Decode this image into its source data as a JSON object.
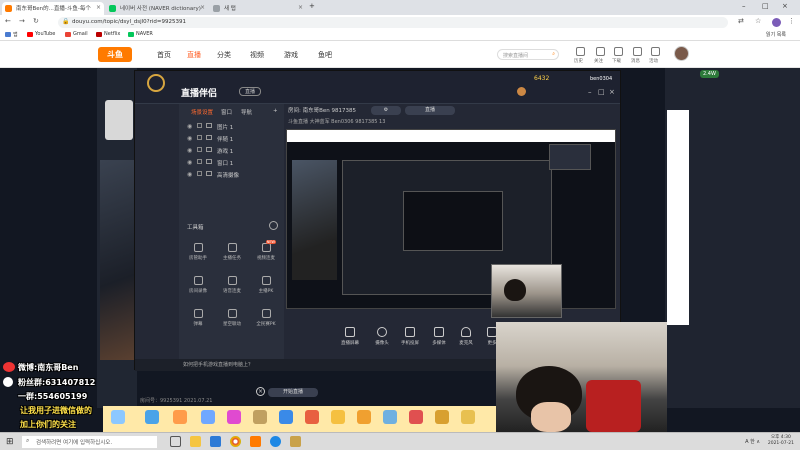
{
  "browser": {
    "tabs": [
      {
        "label": "南东哥Ben的...直播-斗鱼-每个",
        "active": true
      },
      {
        "label": "네이버 사전 (NAVER dictionary)",
        "active": false
      },
      {
        "label": "새 탭",
        "active": false
      }
    ],
    "new_tab": "+",
    "url": "douyu.com/topic/dsyl_dsjl0?rid=9925391",
    "bookmarks": [
      "앱",
      "YouTube",
      "Gmail",
      "Netflix",
      "NAVER"
    ],
    "reading_list": "읽기 목록"
  },
  "site": {
    "logo": "斗鱼",
    "nav": [
      "首页",
      "直播",
      "分类",
      "视频",
      "游戏",
      "鱼吧"
    ],
    "active_nav": "直播",
    "search_placeholder": "搜索直播间",
    "header_icons": [
      "历史",
      "关注",
      "下载",
      "消息",
      "活动"
    ]
  },
  "obs": {
    "title": "直播伴侣",
    "tabs": [
      "场景设置",
      "窗口",
      "导航",
      "+"
    ],
    "sources": [
      "图片 1",
      "伴随 1",
      "游戏 1",
      "窗口 1",
      "高清摄像"
    ],
    "tool_label": "工具箱",
    "tools": [
      [
        "房管助手",
        "主播任务",
        "视频连麦"
      ],
      [
        "房间录像",
        "语音连麦",
        "主播PK"
      ],
      [
        "弹幕",
        "星空联动",
        "全民赛PK"
      ]
    ],
    "room_info": "房间: 南东哥Ben  9817385",
    "info_row2": "斗鱼直播  大神蓝军  Ben0306  9817385  13",
    "status": "直播",
    "bottom_buttons": [
      "直播屏幕",
      "摄像头",
      "手机投屏",
      "多媒体",
      "麦克风",
      "更多"
    ],
    "footer_hint": "如何把手机游戏直播到电脑上？",
    "stream_button": "开始直播"
  },
  "right_panel": {
    "counter": "6432",
    "user": "ben0304",
    "gift_count": "2.4W"
  },
  "overlay": {
    "weibo": "微博:南东哥Ben",
    "fans_group": "粉丝群:631407812",
    "group2": "一群:554605199",
    "follow": "让我用子进微信做的",
    "follow2": "加上你们的关注"
  },
  "room_footer": "房间号：9925391 2021.07.21",
  "taskbar": {
    "search_placeholder": "검색하려면 여기에 입력하십시오.",
    "time": "오후 4:30",
    "date": "2021-07-21",
    "ime": "A 한 ∧"
  }
}
